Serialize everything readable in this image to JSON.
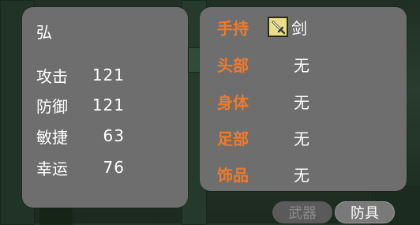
{
  "character": {
    "name": "弘",
    "stats": [
      {
        "label": "攻击",
        "value": "121"
      },
      {
        "label": "防御",
        "value": "121"
      },
      {
        "label": "敏捷",
        "value": "63"
      },
      {
        "label": "幸运",
        "value": "76"
      }
    ]
  },
  "equipment": {
    "slots": [
      {
        "label": "手持",
        "value": "剑",
        "icon": "sword-icon"
      },
      {
        "label": "头部",
        "value": "无"
      },
      {
        "label": "身体",
        "value": "无"
      },
      {
        "label": "足部",
        "value": "无"
      },
      {
        "label": "饰品",
        "value": "无"
      }
    ]
  },
  "tabs": {
    "weapon": "武器",
    "armor": "防具",
    "active": "armor"
  },
  "colors": {
    "panel": "#6f6e6f",
    "slot_label": "#f07a2a",
    "text": "#ffffff",
    "icon_bg": "#e8df86"
  }
}
